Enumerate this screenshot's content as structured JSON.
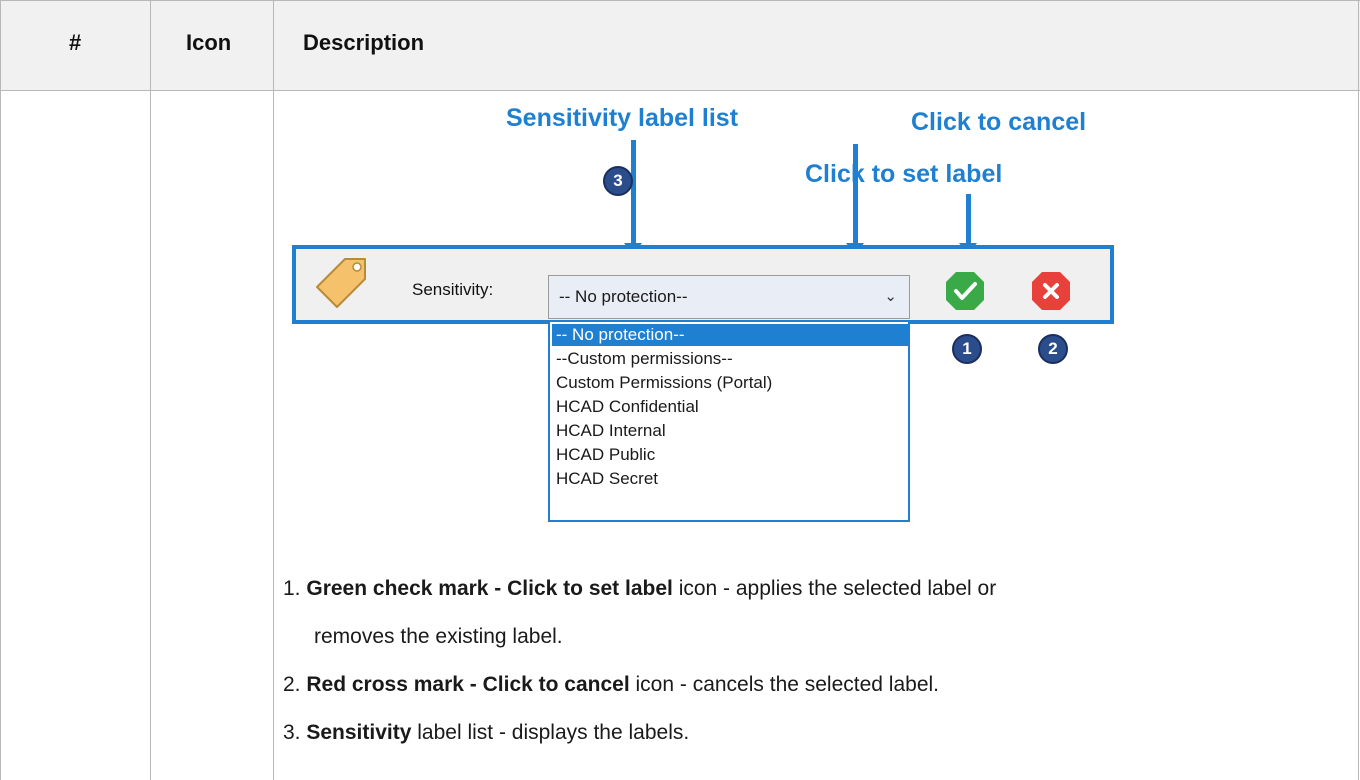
{
  "table": {
    "headers": [
      "#",
      "Icon",
      "Description"
    ]
  },
  "illustration": {
    "callouts": {
      "list": "Sensitivity label list",
      "cancel": "Click to cancel",
      "set": "Click to set label"
    },
    "badges": [
      "3",
      "1",
      "2"
    ],
    "sensitivity_label": "Sensitivity:",
    "selected_value": "-- No protection--",
    "options": [
      "-- No protection--",
      " --Custom permissions--",
      "Custom Permissions (Portal)",
      "HCAD Confidential",
      "HCAD Internal",
      "HCAD Public",
      "HCAD Secret"
    ],
    "colors": {
      "accent": "#1f7fd0",
      "check": "#3aa947",
      "cancel": "#e8403a"
    }
  },
  "descriptions": [
    {
      "num": "1.",
      "bold": "Green check mark - Click to set label",
      "rest": " icon - applies the selected label or",
      "cont": "removes the existing label."
    },
    {
      "num": "2.",
      "bold": "Red cross mark - Click to cancel",
      "rest": " icon - cancels the selected label."
    },
    {
      "num": "3.",
      "bold": "Sensitivity",
      "rest": " label list - displays the labels."
    }
  ]
}
